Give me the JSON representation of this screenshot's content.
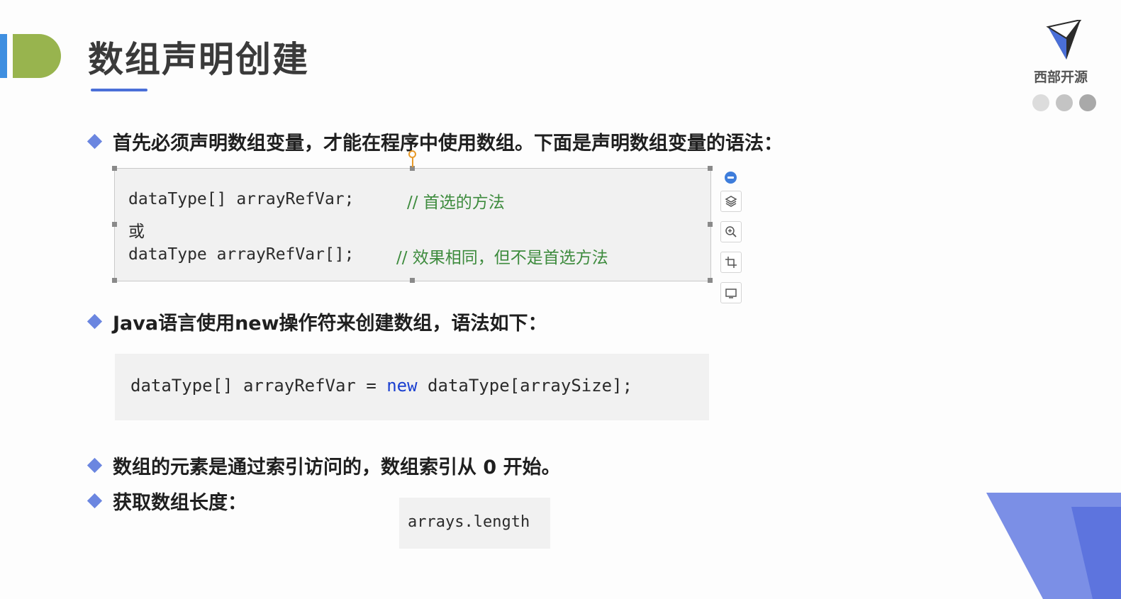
{
  "slide": {
    "title": "数组声明创建",
    "logo_text": "西部开源",
    "colors": {
      "accent_blue": "#4a6fd8",
      "deco_green": "#98b44e",
      "deco_blue": "#3f8fe0",
      "bullet": "#6b86e0",
      "comment": "#3d8b3d",
      "keyword": "#1a3fd0",
      "dots": [
        "#dcdcdc",
        "#c4c4c4",
        "#a9a9a9"
      ]
    },
    "bullets": [
      "首先必须声明数组变量，才能在程序中使用数组。下面是声明数组变量的语法：",
      "Java语言使用new操作符来创建数组，语法如下：",
      "数组的元素是通过索引访问的，数组索引从 0 开始。",
      "获取数组长度："
    ],
    "code_declare": {
      "line1_code": "dataType[] arrayRefVar;",
      "line1_comment": "// 首选的方法",
      "line2": "或",
      "line3_code": "dataType arrayRefVar[];",
      "line3_comment": "// 效果相同，但不是首选方法"
    },
    "code_create": {
      "part1": "dataType[] arrayRefVar = ",
      "keyword": "new",
      "part2": " dataType[arraySize];"
    },
    "code_length": "arrays.length",
    "toolbar_icons": [
      "collapse-icon",
      "layers-icon",
      "zoom-in-icon",
      "crop-icon",
      "frame-icon"
    ]
  }
}
